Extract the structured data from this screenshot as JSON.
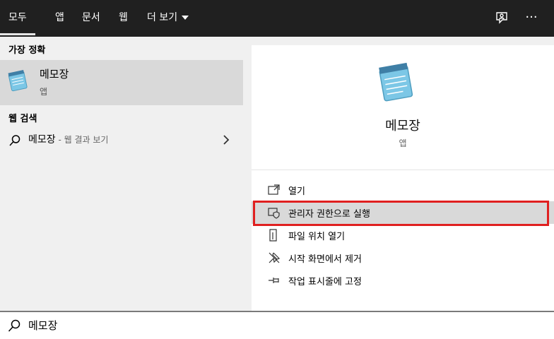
{
  "tabs": [
    {
      "label": "모두",
      "active": true
    },
    {
      "label": "앱"
    },
    {
      "label": "문서"
    },
    {
      "label": "웹"
    },
    {
      "label": "더 보기"
    }
  ],
  "topbar_icons": [
    "feedback-icon",
    "more-options-icon"
  ],
  "more_options_glyph": "···",
  "left": {
    "best_match_heading": "가장 정확",
    "best_match": {
      "title": "메모장",
      "type": "앱",
      "icon": "notepad-icon"
    },
    "web_heading": "웹 검색",
    "web_item": {
      "query": "메모장",
      "suffix": " - 웹 결과 보기"
    }
  },
  "right": {
    "app_name": "메모장",
    "app_type": "앱",
    "actions": [
      {
        "label": "열기",
        "icon": "open-icon"
      },
      {
        "label": "관리자 권한으로 실행",
        "icon": "admin-shield-icon",
        "highlighted": true
      },
      {
        "label": "파일 위치 열기",
        "icon": "file-location-icon"
      },
      {
        "label": "시작 화면에서 제거",
        "icon": "unpin-icon"
      },
      {
        "label": "작업 표시줄에 고정",
        "icon": "pin-icon"
      }
    ]
  },
  "search": {
    "value": "메모장"
  },
  "colors": {
    "topbar": "#202020",
    "highlight_border": "#e02020",
    "selected_bg": "#d9d9d9"
  }
}
